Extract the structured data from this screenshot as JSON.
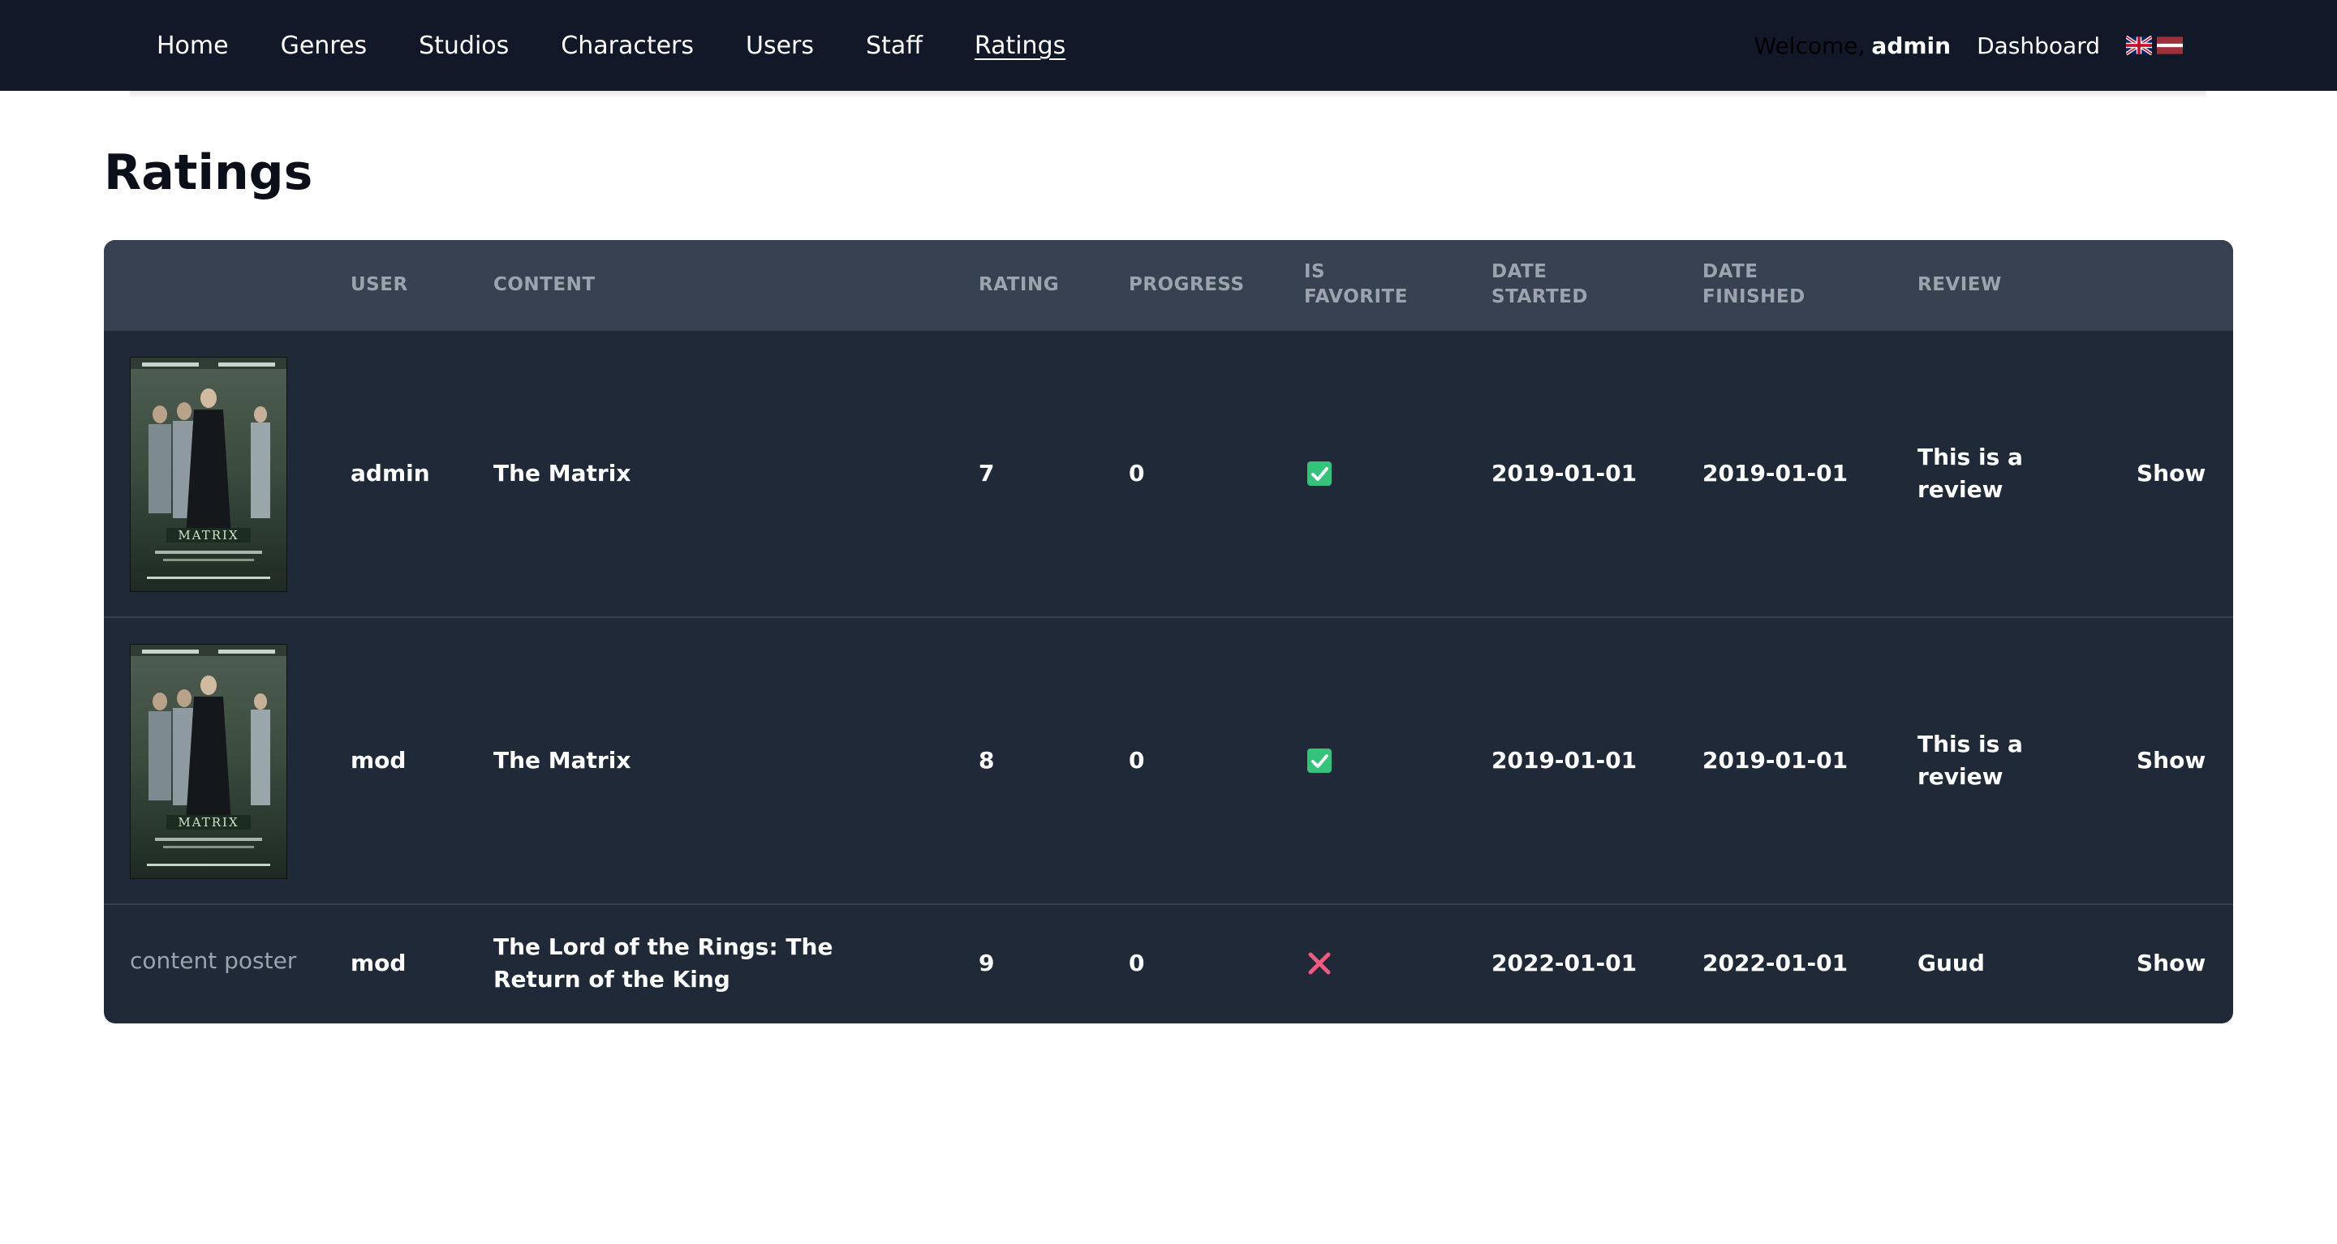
{
  "nav": {
    "links": [
      "Home",
      "Genres",
      "Studios",
      "Characters",
      "Users",
      "Staff",
      "Ratings"
    ],
    "active": "Ratings",
    "welcome_text": "Welcome,",
    "username": "admin",
    "dashboard_label": "Dashboard",
    "flags": [
      "uk-flag-icon",
      "latvia-flag-icon"
    ]
  },
  "page": {
    "title": "Ratings"
  },
  "table": {
    "headers": {
      "user": "USER",
      "content": "CONTENT",
      "rating": "RATING",
      "progress": "PROGRESS",
      "is_favorite_1": "IS",
      "is_favorite_2": "FAVORITE",
      "date_started_1": "DATE",
      "date_started_2": "STARTED",
      "date_finished_1": "DATE",
      "date_finished_2": "FINISHED",
      "review": "REVIEW"
    },
    "rows": [
      {
        "poster": "matrix-poster",
        "poster_alt": "",
        "user": "admin",
        "content": "The Matrix",
        "rating": "7",
        "progress": "0",
        "is_favorite": true,
        "date_started": "2019-01-01",
        "date_finished": "2019-01-01",
        "review": "This is a review",
        "action": "Show"
      },
      {
        "poster": "matrix-poster",
        "poster_alt": "",
        "user": "mod",
        "content": "The Matrix",
        "rating": "8",
        "progress": "0",
        "is_favorite": true,
        "date_started": "2019-01-01",
        "date_finished": "2019-01-01",
        "review": "This is a review",
        "action": "Show"
      },
      {
        "poster": "",
        "poster_alt": "content poster",
        "user": "mod",
        "content": "The Lord of the Rings: The Return of the King",
        "rating": "9",
        "progress": "0",
        "is_favorite": false,
        "date_started": "2022-01-01",
        "date_finished": "2022-01-01",
        "review": "Guud",
        "action": "Show"
      }
    ]
  },
  "colors": {
    "navbar_bg": "#111827",
    "table_bg": "#1f2937",
    "header_bg": "#374151",
    "favorite_yes": "#34c37a",
    "favorite_no": "#f05a7e"
  }
}
